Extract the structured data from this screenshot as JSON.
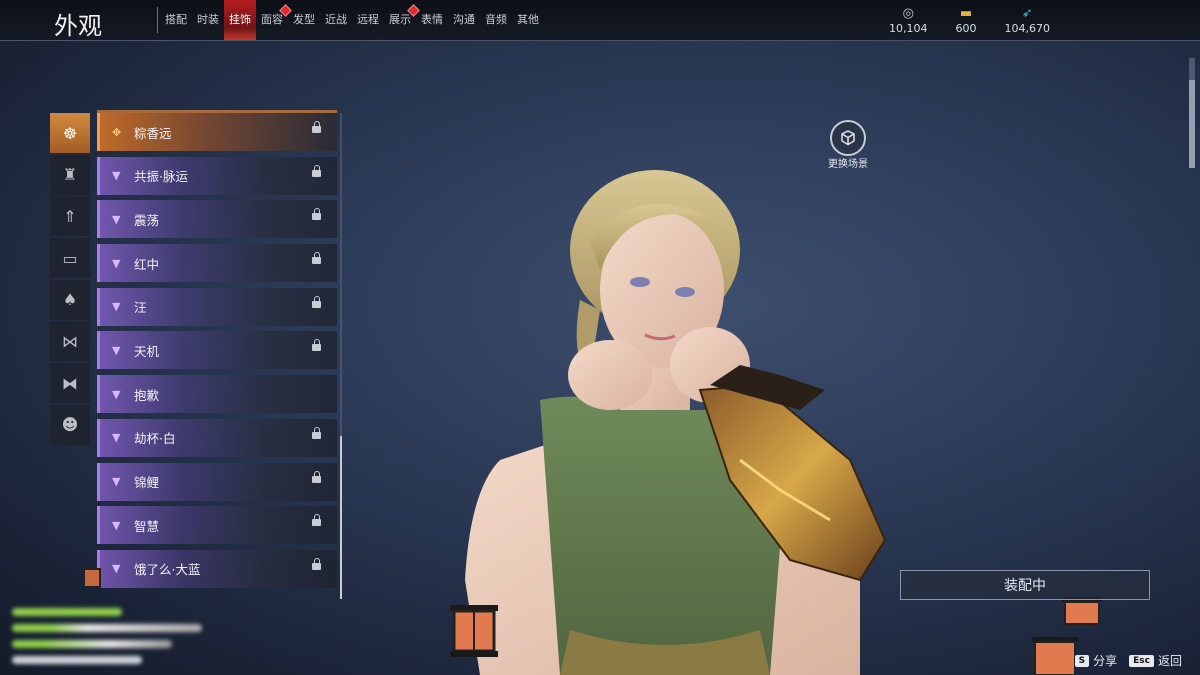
{
  "header": {
    "title": "外观",
    "tabs": [
      {
        "label": "搭配",
        "active": false,
        "alert": false
      },
      {
        "label": "时装",
        "active": false,
        "alert": false
      },
      {
        "label": "挂饰",
        "active": true,
        "alert": false
      },
      {
        "label": "面容",
        "active": false,
        "alert": true
      },
      {
        "label": "发型",
        "active": false,
        "alert": false
      },
      {
        "label": "近战",
        "active": false,
        "alert": false
      },
      {
        "label": "远程",
        "active": false,
        "alert": false
      },
      {
        "label": "展示",
        "active": false,
        "alert": true
      },
      {
        "label": "表情",
        "active": false,
        "alert": false
      },
      {
        "label": "沟通",
        "active": false,
        "alert": false
      },
      {
        "label": "音频",
        "active": false,
        "alert": false
      },
      {
        "label": "其他",
        "active": false,
        "alert": false
      }
    ],
    "currencies": [
      {
        "icon": "coin-icon",
        "value": "10,104"
      },
      {
        "icon": "gold-bar-icon",
        "value": "600"
      },
      {
        "icon": "feather-icon",
        "value": "104,670"
      }
    ]
  },
  "categories": [
    {
      "icon": "mask-icon",
      "active": true
    },
    {
      "icon": "helmet-icon",
      "active": false
    },
    {
      "icon": "arrow-ornament-icon",
      "active": false
    },
    {
      "icon": "waist-icon",
      "active": false
    },
    {
      "icon": "cape-icon",
      "active": false
    },
    {
      "icon": "bow-icon",
      "active": false
    },
    {
      "icon": "knot-icon",
      "active": false
    },
    {
      "icon": "demon-mask-icon",
      "active": false
    }
  ],
  "items": [
    {
      "label": "粽香远",
      "locked": true
    },
    {
      "label": "共振·脉运",
      "locked": true
    },
    {
      "label": "震荡",
      "locked": true
    },
    {
      "label": "红中",
      "locked": true
    },
    {
      "label": "汪",
      "locked": true
    },
    {
      "label": "天机",
      "locked": true
    },
    {
      "label": "抱歉",
      "locked": false
    },
    {
      "label": "劫杯·白",
      "locked": true
    },
    {
      "label": "锦鲤",
      "locked": true
    },
    {
      "label": "智慧",
      "locked": true
    },
    {
      "label": "饿了么·大蓝",
      "locked": true
    }
  ],
  "scene": {
    "label": "更换场景"
  },
  "equip_button": {
    "label": "装配中"
  },
  "hints": [
    {
      "key": "S",
      "label": "分享"
    },
    {
      "key": "Esc",
      "label": "返回"
    }
  ],
  "colors": {
    "active_tab": "#c0281e",
    "active_category": "#c47a38",
    "purple_rarity": "#a87fe6",
    "orange_rarity": "#f0a050"
  }
}
